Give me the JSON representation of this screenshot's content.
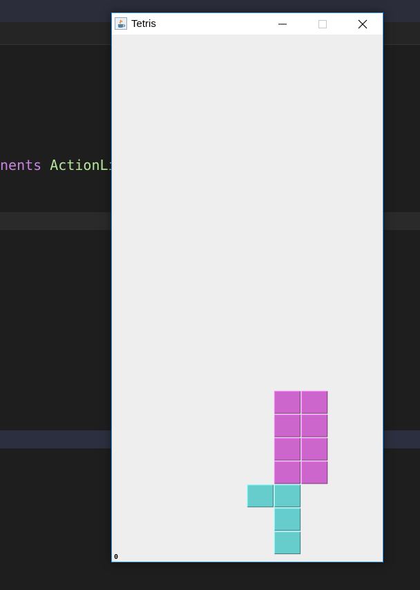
{
  "editor": {
    "code_keyword": "nents",
    "code_type": "ActionLi"
  },
  "window": {
    "title": "Tetris",
    "icon": "java-coffee-icon",
    "controls": [
      "minimize-icon",
      "maximize-icon",
      "close-icon"
    ]
  },
  "game": {
    "score": "0",
    "colors": {
      "purple": "#cc66cc",
      "cyan": "#66cccc"
    },
    "blocks": [
      {
        "col": 6,
        "row": 15,
        "color": "purple"
      },
      {
        "col": 7,
        "row": 15,
        "color": "purple"
      },
      {
        "col": 6,
        "row": 16,
        "color": "purple"
      },
      {
        "col": 7,
        "row": 16,
        "color": "purple"
      },
      {
        "col": 6,
        "row": 17,
        "color": "purple"
      },
      {
        "col": 7,
        "row": 17,
        "color": "purple"
      },
      {
        "col": 6,
        "row": 18,
        "color": "purple"
      },
      {
        "col": 7,
        "row": 18,
        "color": "purple"
      },
      {
        "col": 5,
        "row": 19,
        "color": "cyan"
      },
      {
        "col": 6,
        "row": 19,
        "color": "cyan"
      },
      {
        "col": 6,
        "row": 20,
        "color": "cyan"
      },
      {
        "col": 6,
        "row": 21,
        "color": "cyan"
      }
    ]
  }
}
